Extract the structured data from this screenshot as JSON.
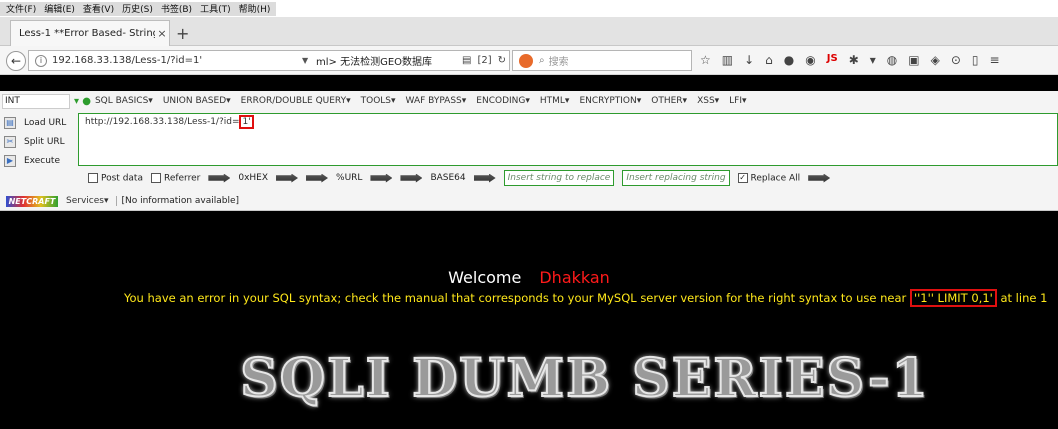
{
  "menubar": [
    "文件(F)",
    "编辑(E)",
    "查看(V)",
    "历史(S)",
    "书签(B)",
    "工具(T)",
    "帮助(H)"
  ],
  "tab": {
    "title": "Less-1 **Error Based- String...",
    "close": "×",
    "new": "+"
  },
  "nav": {
    "url": "192.168.33.138/Less-1/?id=1'",
    "extra": "ml>   无法检测GEO数据库",
    "counter": "[2]",
    "search_placeholder": "搜索",
    "js_label": "JS"
  },
  "hackbar": {
    "select": "INT",
    "menu": [
      "SQL BASICS▾",
      "UNION BASED▾",
      "ERROR/DOUBLE QUERY▾",
      "TOOLS▾",
      "WAF BYPASS▾",
      "ENCODING▾",
      "HTML▾",
      "ENCRYPTION▾",
      "OTHER▾",
      "XSS▾",
      "LFI▾"
    ],
    "actions": [
      "Load URL",
      "Split URL",
      "Execute"
    ],
    "url_prefix": "http://192.168.33.138/Less-1/?id=",
    "url_highlight": "1'",
    "post_data": "Post data",
    "referrer": "Referrer",
    "hex": "0xHEX",
    "urlenc": "%URL",
    "base64": "BASE64",
    "insert_replace": "Insert string to replace",
    "insert_replacing": "Insert replacing string",
    "replace_all": "Replace All",
    "netcraft": "NETCRAFT",
    "services": "Services▾",
    "no_info": "[No information available]"
  },
  "page": {
    "welcome": "Welcome",
    "name": "Dhakkan",
    "error_prefix": "You have an error in your SQL syntax; check the manual that corresponds to your MySQL server version for the right syntax to use near ",
    "error_highlight": "''1'' LIMIT 0,1'",
    "error_suffix": " at line 1",
    "banner": "SQLI DUMB SERIES-1"
  }
}
